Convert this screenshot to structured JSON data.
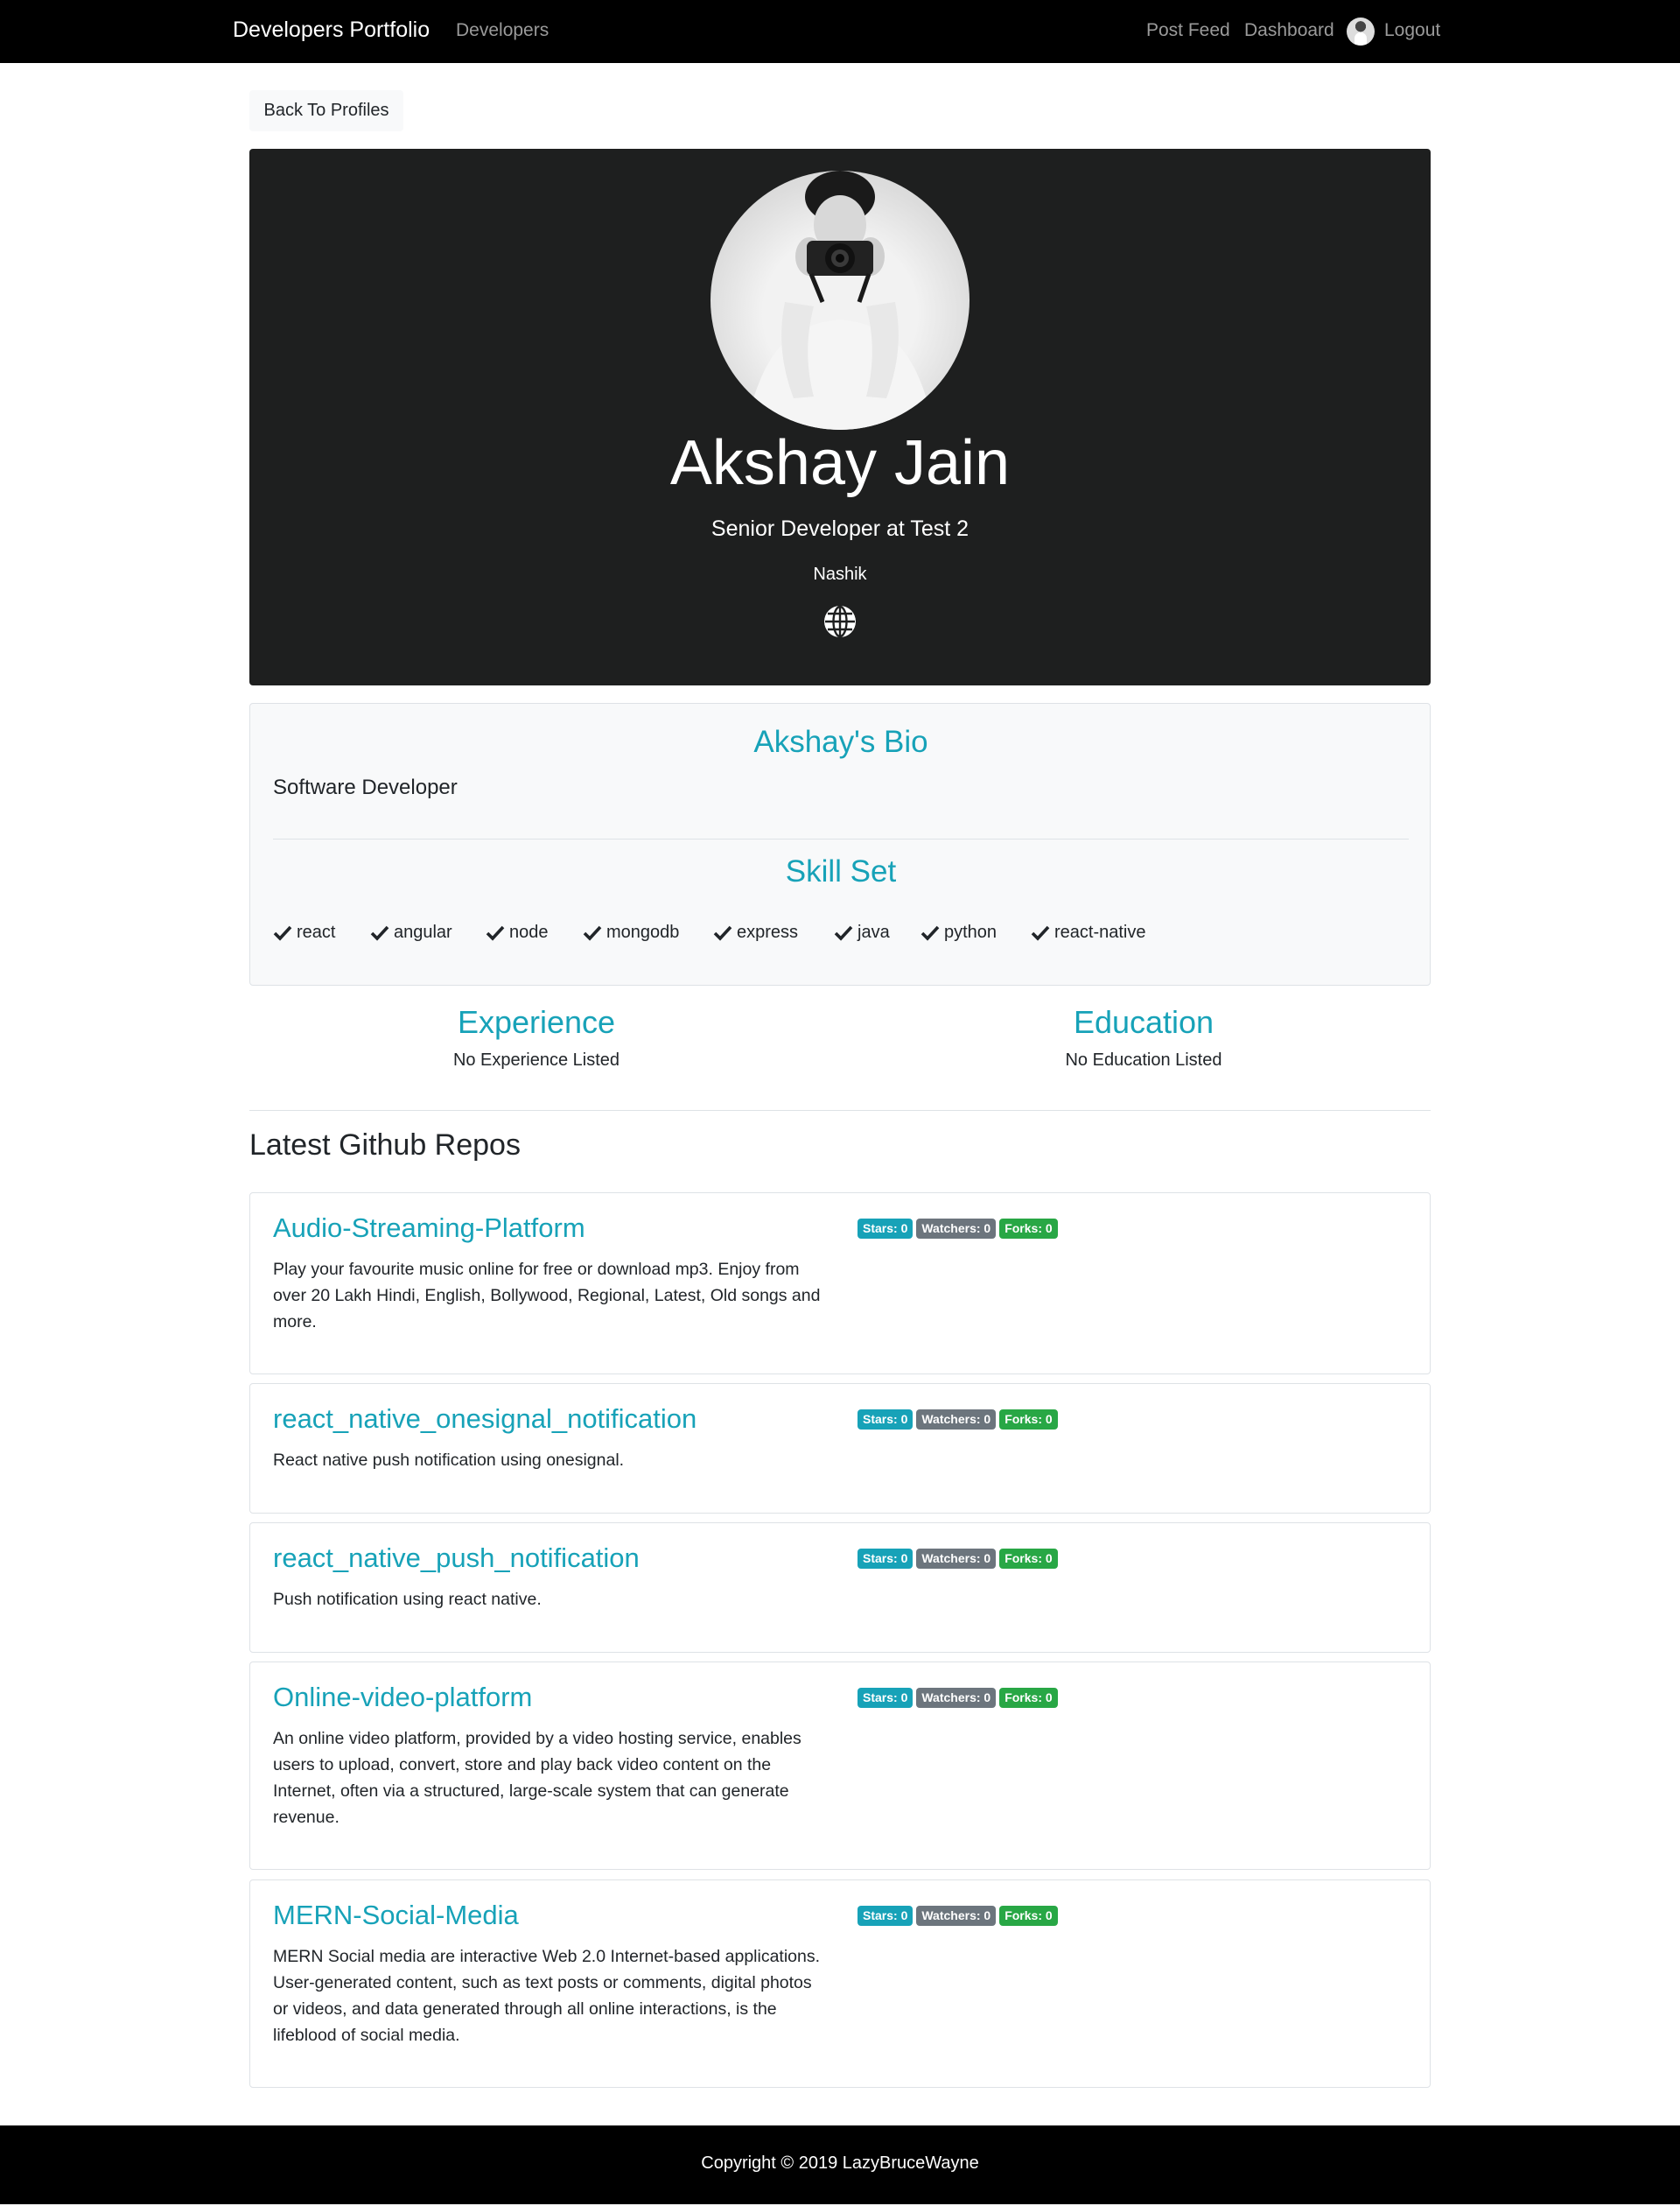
{
  "navbar": {
    "brand": "Developers Portfolio",
    "developers": "Developers",
    "post_feed": "Post Feed",
    "dashboard": "Dashboard",
    "logout": "Logout"
  },
  "back_button": "Back To Profiles",
  "profile": {
    "name": "Akshay Jain",
    "status": "Senior Developer at Test 2",
    "location": "Nashik",
    "website_icon": "globe-icon"
  },
  "bio": {
    "title": "Akshay's Bio",
    "text": "Software Developer",
    "skill_title": "Skill Set",
    "skills": [
      "react",
      "angular",
      "node",
      "mongodb",
      "express",
      "java",
      "python",
      "react-native"
    ]
  },
  "experience": {
    "title": "Experience",
    "empty": "No Experience Listed"
  },
  "education": {
    "title": "Education",
    "empty": "No Education Listed"
  },
  "repos_heading": "Latest Github Repos",
  "repos": [
    {
      "name": "Audio-Streaming-Platform",
      "description": "Play your favourite music online for free or download mp3. Enjoy from over 20 Lakh Hindi, English, Bollywood, Regional, Latest, Old songs and more.",
      "stars": "Stars: 0",
      "watchers": "Watchers: 0",
      "forks": "Forks: 0"
    },
    {
      "name": "react_native_onesignal_notification",
      "description": "React native push notification using onesignal.",
      "stars": "Stars: 0",
      "watchers": "Watchers: 0",
      "forks": "Forks: 0"
    },
    {
      "name": "react_native_push_notification",
      "description": "Push notification using react native.",
      "stars": "Stars: 0",
      "watchers": "Watchers: 0",
      "forks": "Forks: 0"
    },
    {
      "name": "Online-video-platform",
      "description": "An online video platform, provided by a video hosting service, enables users to upload, convert, store and play back video content on the Internet, often via a structured, large-scale system that can generate revenue.",
      "stars": "Stars: 0",
      "watchers": "Watchers: 0",
      "forks": "Forks: 0"
    },
    {
      "name": "MERN-Social-Media",
      "description": "MERN Social media are interactive Web 2.0 Internet-based applications. User-generated content, such as text posts or comments, digital photos or videos, and data generated through all online interactions, is the lifeblood of social media.",
      "stars": "Stars: 0",
      "watchers": "Watchers: 0",
      "forks": "Forks: 0"
    }
  ],
  "footer": "Copyright © 2019 LazyBruceWayne",
  "colors": {
    "accent": "#17a2b8",
    "secondary": "#6c757d",
    "success": "#28a745",
    "hero_bg": "#1e1f1f",
    "navbar_bg": "#000000"
  }
}
